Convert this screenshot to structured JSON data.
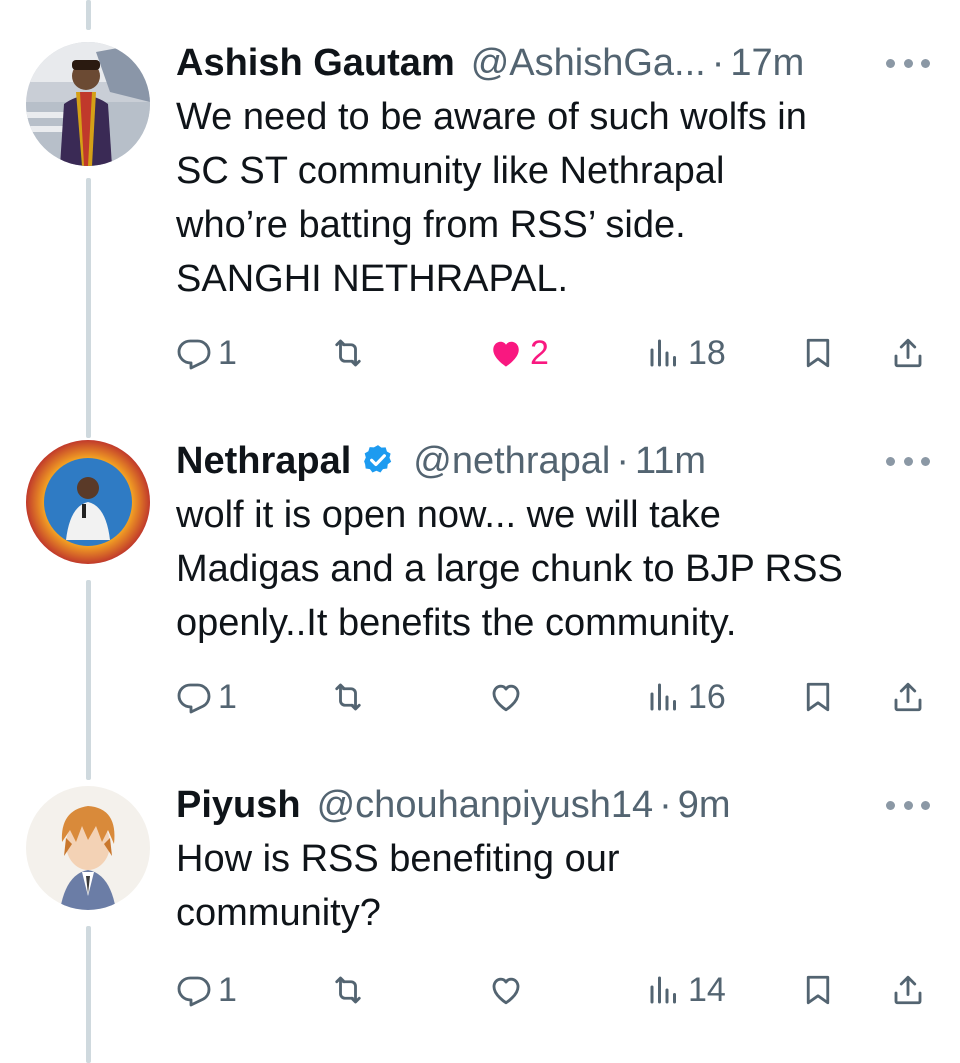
{
  "tweets": [
    {
      "name": "Ashish Gautam",
      "verified": false,
      "handle": "@AshishGa...",
      "dot": "·",
      "time": "17m",
      "text": "We need to be aware of such wolfs in\nSC ST community like Nethrapal\nwho’re batting from RSS’ side.\nSANGHI NETHRAPAL.",
      "replies": "1",
      "retweets": "",
      "likes": "2",
      "liked": true,
      "views": "18",
      "avatar_icon": "user-photo-avatar"
    },
    {
      "name": "Nethrapal",
      "verified": true,
      "handle": "@nethrapal",
      "dot": "·",
      "time": "11m",
      "text": "wolf it is open now... we will take\nMadigas and a large chunk to BJP RSS\nopenly..It benefits the community.",
      "replies": "1",
      "retweets": "",
      "likes": "",
      "liked": false,
      "views": "16",
      "avatar_icon": "user-photo-avatar"
    },
    {
      "name": "Piyush",
      "verified": false,
      "handle": "@chouhanpiyush14",
      "dot": "·",
      "time": "9m",
      "text": "How is RSS benefiting our\ncommunity?",
      "replies": "1",
      "retweets": "",
      "likes": "",
      "liked": false,
      "views": "14",
      "avatar_icon": "anime-character-avatar"
    }
  ],
  "colors": {
    "text": "#0f1419",
    "secondary": "#536471",
    "like": "#f91880",
    "verified": "#1d9bf0",
    "thread_line": "#cfd9de"
  }
}
